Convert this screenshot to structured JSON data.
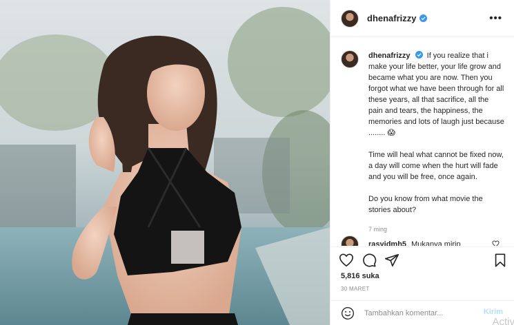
{
  "post": {
    "username": "dhenafrizzy",
    "more_label": "•••"
  },
  "caption": {
    "username": "dhenafrizzy",
    "paragraph1": "If you realize that i make your life better, your life grow and became what you are now. Then you forgot what we have been through for all these years, all that sacrifice, all the pain and tears, the happiness, the memories and lots of laugh just because ........ 😱",
    "paragraph2": "Time will heal what cannot be fixed now, a day will come when the hurt will fade and you will be free, once again.",
    "paragraph3": "Do you know from what movie the stories about?",
    "time": "7 ming"
  },
  "reply": {
    "username": "rasyidmh5",
    "text": "Mukanya mirip"
  },
  "actions": {
    "likes": "5,816 suka",
    "date": "30 MARET"
  },
  "comment_box": {
    "placeholder": "Tambahkan komentar...",
    "post_label": "Kirim"
  },
  "watermark": "Activ",
  "colors": {
    "verified": "#3897f0",
    "post_button": "#b2dffc",
    "muted": "#8e8e8e"
  }
}
